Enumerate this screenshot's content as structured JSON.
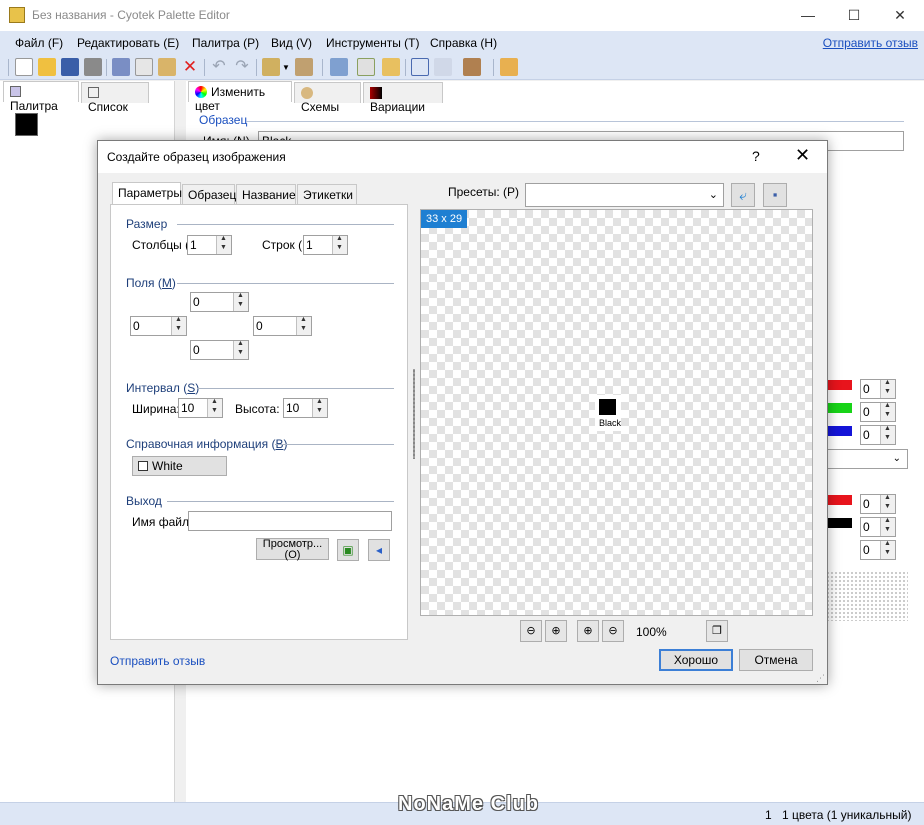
{
  "window": {
    "title": "Без названия - Cyotek Palette Editor",
    "minimize_glyph": "—",
    "maximize_glyph": "☐",
    "close_glyph": "✕"
  },
  "menu": {
    "items": [
      "Файл (F)",
      "Редактировать (E)",
      "Палитра (P)",
      "Вид (V)",
      "Инструменты (T)",
      "Справка (H)"
    ],
    "feedback": "Отправить отзыв"
  },
  "left_tabs": [
    "Палитра",
    "Список"
  ],
  "right_tabs": [
    "Изменить цвет",
    "Схемы",
    "Вариации"
  ],
  "editor": {
    "sample_group": "Образец",
    "name_label": "Имя: (N)",
    "name_value": "Black",
    "channel_values": [
      "0",
      "0",
      "0",
      "0",
      "0",
      "0"
    ]
  },
  "status": {
    "count": "1",
    "summary": "1 цвета (1 уникальный)"
  },
  "watermark": "NoNaMe Club",
  "dialog": {
    "title": "Создайте образец изображения",
    "help": "?",
    "close": "✕",
    "tabs": [
      "Параметры",
      "Образец",
      "Название",
      "Этикетки"
    ],
    "size": {
      "title": "Размер",
      "columns_label": "Столбцы (",
      "columns_value": "1",
      "rows_label": "Строк (R",
      "rows_value": "1"
    },
    "margins": {
      "title": "Поля",
      "hotkey": "M",
      "top": "0",
      "left": "0",
      "right": "0",
      "bottom": "0"
    },
    "spacing": {
      "title": "Интервал",
      "hotkey": "S",
      "width_label": "Ширина:",
      "width_value": "10",
      "height_label": "Высота:",
      "height_value": "10"
    },
    "reference": {
      "title": "Справочная информация",
      "hotkey": "B",
      "color_name": "White"
    },
    "output": {
      "title": "Выход",
      "filename_label": "Имя файла",
      "filename_value": "",
      "preview_button": "Просмотр... (O)"
    },
    "presets_label": "Пресеты: (P)",
    "presets_value": "",
    "preview": {
      "size_badge": "33 x 29",
      "swatch_label": "Black",
      "zoom": "100%"
    },
    "feedback": "Отправить отзыв",
    "ok": "Хорошо",
    "cancel": "Отмена"
  },
  "colors": {
    "menubar": "#dde6f5",
    "accent": "#1e7fd2",
    "link": "#1a4fbf",
    "swatch": "#000000",
    "rgb_red": "#e8141c",
    "rgb_green": "#18d418",
    "rgb_blue": "#1414d8"
  }
}
